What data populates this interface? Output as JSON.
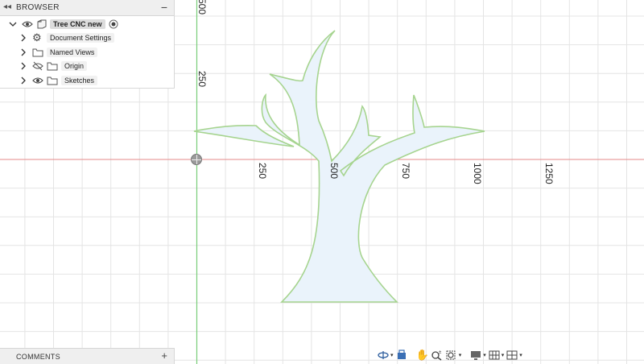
{
  "browser": {
    "title": "BROWSER",
    "collapse_glyph": "◂◂",
    "minimize_glyph": "−",
    "root": {
      "label": "Tree CNC new",
      "icon": "component-icon",
      "radio": "active-radio"
    },
    "items": [
      {
        "label": "Document Settings",
        "icon": "gear-icon",
        "eye": null
      },
      {
        "label": "Named Views",
        "icon": "folder-icon",
        "eye": null
      },
      {
        "label": "Origin",
        "icon": "folder-icon",
        "eye": "eye-hidden-icon"
      },
      {
        "label": "Sketches",
        "icon": "folder-icon",
        "eye": "eye-icon"
      }
    ]
  },
  "comments": {
    "title": "COMMENTS",
    "add_glyph": "+"
  },
  "grid": {
    "x_ticks": [
      "250",
      "500",
      "750",
      "1000",
      "1250"
    ],
    "y_ticks": [
      "500",
      "250"
    ]
  },
  "colors": {
    "x_axis": "#e58a8a",
    "y_axis": "#77cc77",
    "grid": "#e4e4e4",
    "profile_stroke": "#a6d48f",
    "profile_fill": "#eaf3fb"
  },
  "nav_toolbar": [
    "orbit-icon",
    "look-at-icon",
    "pan-icon",
    "zoom-icon",
    "fit-icon",
    "display-settings-icon",
    "grid-settings-icon",
    "viewports-icon"
  ]
}
